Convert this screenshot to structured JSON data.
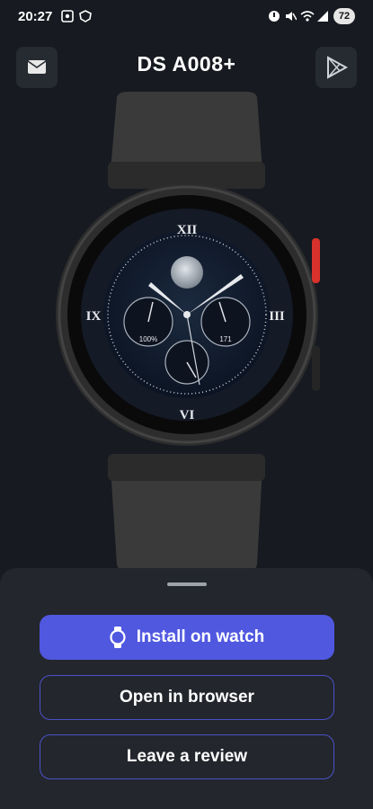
{
  "status_bar": {
    "time": "20:27",
    "battery": "72",
    "icons": [
      "screenshot-icon",
      "vpn-icon",
      "alarm-icon",
      "mute-icon",
      "wifi-icon",
      "signal-icon"
    ]
  },
  "header": {
    "title": "DS A008+",
    "left_icon": "mail-icon",
    "right_icon": "play-store-icon"
  },
  "watch_face": {
    "hour_numerals": [
      "XII",
      "III",
      "VI",
      "IX"
    ],
    "left_dial_value": "100%",
    "right_dial_value": "171"
  },
  "actions": {
    "install_label": "Install on watch",
    "open_label": "Open in browser",
    "review_label": "Leave a review"
  },
  "colors": {
    "accent": "#5058e0",
    "background": "#171a20",
    "sheet": "#23262c",
    "crown": "#d9312b"
  }
}
